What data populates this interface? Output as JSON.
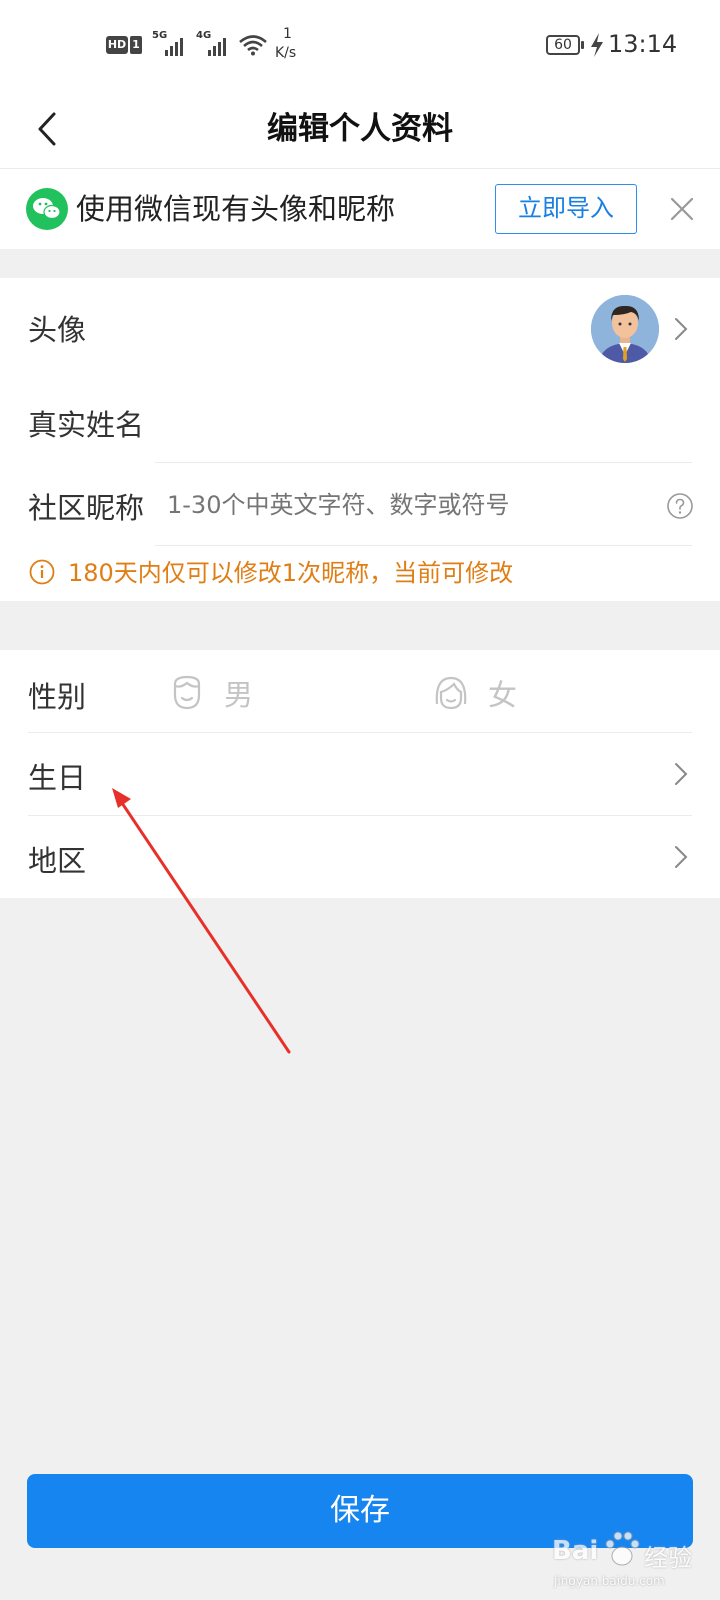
{
  "status_bar": {
    "hd_label": "HD",
    "sim_label": "1",
    "net_5g": "5G",
    "net_4g": "4G",
    "speed_value": "1",
    "speed_unit": "K/s",
    "battery": "60",
    "time": "13:14"
  },
  "header": {
    "title": "编辑个人资料"
  },
  "wechat_banner": {
    "text": "使用微信现有头像和昵称",
    "import_label": "立即导入"
  },
  "profile": {
    "avatar_label": "头像",
    "real_name_label": "真实姓名",
    "nickname_label": "社区昵称",
    "nickname_placeholder": "1-30个中英文字符、数字或符号",
    "nickname_notice": "180天内仅可以修改1次昵称，当前可修改"
  },
  "details": {
    "gender_label": "性别",
    "male_label": "男",
    "female_label": "女",
    "birthday_label": "生日",
    "region_label": "地区"
  },
  "save_label": "保存",
  "watermark": {
    "brand": "Bai",
    "brand2": "经验",
    "url": "jingyan.baidu.com"
  },
  "colors": {
    "primary": "#1785f0",
    "notice": "#e07e16",
    "wechat": "#21c25e",
    "annotation_arrow": "#e8302a"
  }
}
